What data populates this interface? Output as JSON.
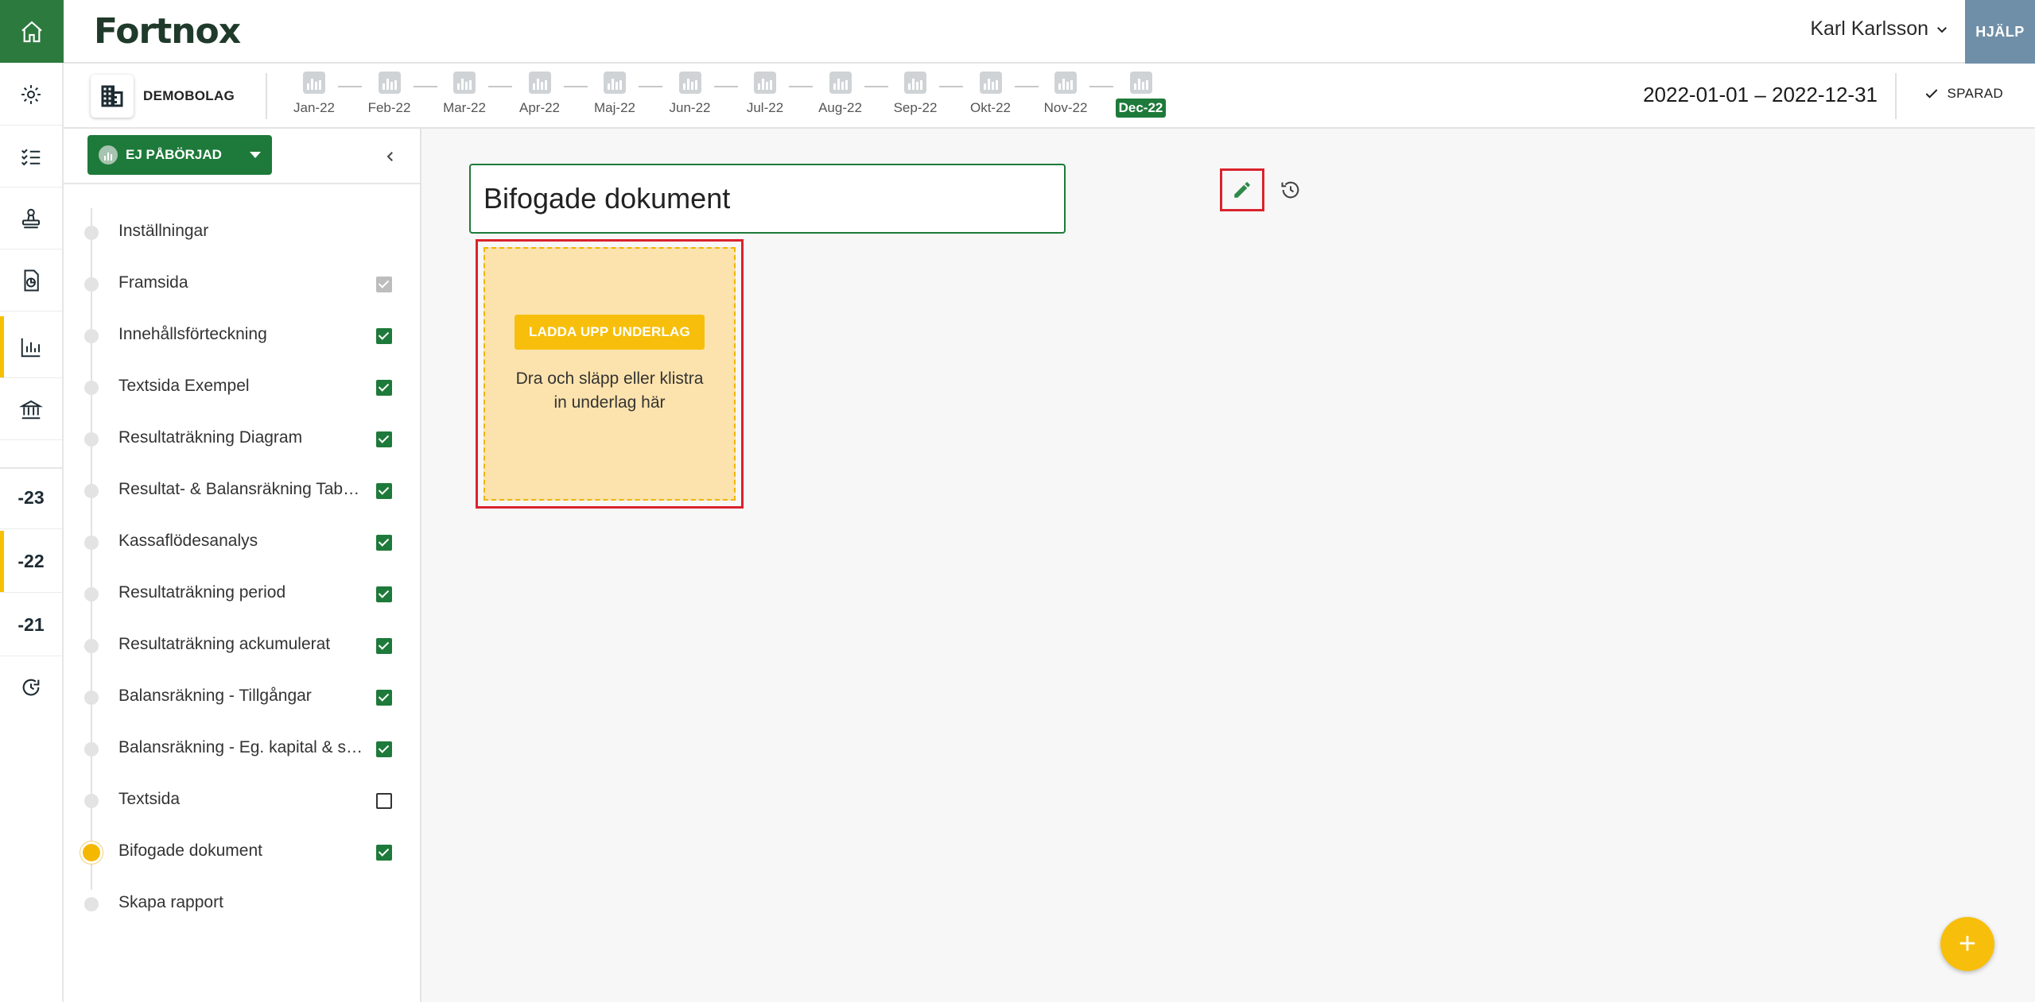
{
  "app": {
    "logo": "Fortnox",
    "user_name": "Karl Karlsson",
    "help_label": "HJÄLP",
    "company_name": "DEMOBOLAG",
    "period": "2022-01-01 – 2022-12-31",
    "saved_label": "SPARAD"
  },
  "rail": {
    "years": [
      "-23",
      "-22",
      "-21"
    ],
    "active_year": "-22"
  },
  "months": [
    {
      "label": "Jan-22"
    },
    {
      "label": "Feb-22"
    },
    {
      "label": "Mar-22"
    },
    {
      "label": "Apr-22"
    },
    {
      "label": "Maj-22"
    },
    {
      "label": "Jun-22"
    },
    {
      "label": "Jul-22"
    },
    {
      "label": "Aug-22"
    },
    {
      "label": "Sep-22"
    },
    {
      "label": "Okt-22"
    },
    {
      "label": "Nov-22"
    },
    {
      "label": "Dec-22"
    }
  ],
  "active_month": "Dec-22",
  "panel": {
    "status_label": "EJ PÅBÖRJAD",
    "steps": [
      {
        "label": "Inställningar",
        "check": "none"
      },
      {
        "label": "Framsida",
        "check": "grey"
      },
      {
        "label": "Innehållsförteckning",
        "check": "on"
      },
      {
        "label": "Textsida Exempel",
        "check": "on"
      },
      {
        "label": "Resultaträkning Diagram",
        "check": "on"
      },
      {
        "label": "Resultat- & Balansräkning Tab…",
        "check": "on"
      },
      {
        "label": "Kassaflödesanalys",
        "check": "on"
      },
      {
        "label": "Resultaträkning period",
        "check": "on"
      },
      {
        "label": "Resultaträkning ackumulerat",
        "check": "on"
      },
      {
        "label": "Balansräkning - Tillgångar",
        "check": "on"
      },
      {
        "label": "Balansräkning - Eg. kapital & s…",
        "check": "on"
      },
      {
        "label": "Textsida",
        "check": "off"
      },
      {
        "label": "Bifogade dokument",
        "check": "on"
      },
      {
        "label": "Skapa rapport",
        "check": "none"
      }
    ],
    "current_step": "Bifogade dokument"
  },
  "main": {
    "title_value": "Bifogade dokument",
    "upload_button_label": "LADDA UPP UNDERLAG",
    "upload_hint": "Dra och släpp eller klistra in underlag här"
  },
  "colors": {
    "brand_green": "#1e7a3a",
    "accent_yellow": "#f7bf0b",
    "help_bg": "#6f8fa8",
    "highlight_red": "#d9232d"
  }
}
